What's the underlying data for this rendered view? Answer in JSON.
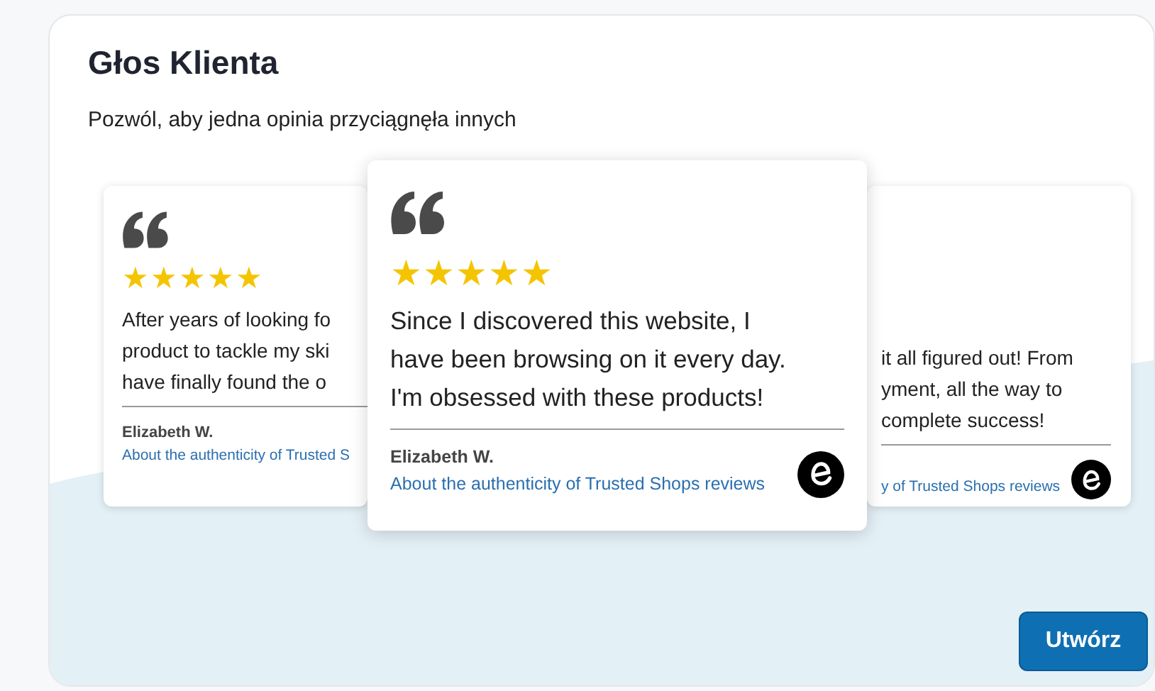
{
  "panel": {
    "title": "Głos Klienta",
    "subtitle": "Pozwól, aby jedna opinia przyciągnęła innych"
  },
  "review_cards": [
    {
      "kind": "side",
      "stars": 5,
      "text_lines": [
        "After years of looking fo",
        "product to tackle my ski",
        "have finally found the o"
      ],
      "author": "Elizabeth W.",
      "link": "About the authenticity of Trusted S",
      "trusted_badge": false
    },
    {
      "kind": "featured",
      "stars": 5,
      "text_lines": [
        "Since I discovered this website, I",
        "have been browsing on it every day.",
        "I'm obsessed with these products!"
      ],
      "author": "Elizabeth W.",
      "link": "About the authenticity of Trusted Shops reviews",
      "trusted_badge": true
    },
    {
      "kind": "side",
      "text_lines": [
        "it all figured out! From",
        "yment, all the way to",
        "complete success!"
      ],
      "link": "y of Trusted Shops reviews",
      "trusted_badge": true
    }
  ],
  "create_button": {
    "label": "Utwórz"
  }
}
